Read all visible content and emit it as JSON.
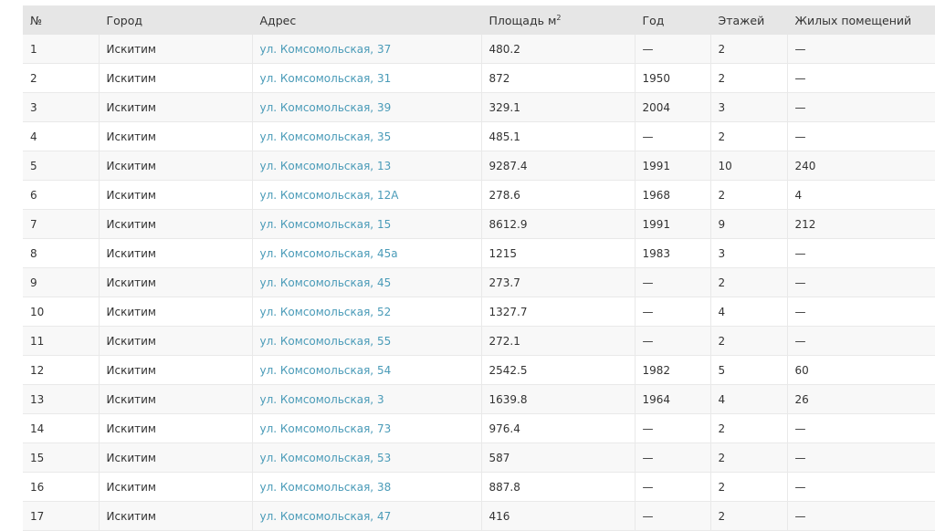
{
  "table": {
    "headers": {
      "num": "№",
      "city": "Город",
      "address": "Адрес",
      "area": "Площадь м",
      "area_sup": "2",
      "year": "Год",
      "floors": "Этажей",
      "residential": "Жилых помещений"
    },
    "rows": [
      {
        "num": "1",
        "city": "Искитим",
        "address": "ул. Комсомольская, 37",
        "area": "480.2",
        "year": "—",
        "floors": "2",
        "residential": "—"
      },
      {
        "num": "2",
        "city": "Искитим",
        "address": "ул. Комсомольская, 31",
        "area": "872",
        "year": "1950",
        "floors": "2",
        "residential": "—"
      },
      {
        "num": "3",
        "city": "Искитим",
        "address": "ул. Комсомольская, 39",
        "area": "329.1",
        "year": "2004",
        "floors": "3",
        "residential": "—"
      },
      {
        "num": "4",
        "city": "Искитим",
        "address": "ул. Комсомольская, 35",
        "area": "485.1",
        "year": "—",
        "floors": "2",
        "residential": "—"
      },
      {
        "num": "5",
        "city": "Искитим",
        "address": "ул. Комсомольская, 13",
        "area": "9287.4",
        "year": "1991",
        "floors": "10",
        "residential": "240"
      },
      {
        "num": "6",
        "city": "Искитим",
        "address": "ул. Комсомольская, 12А",
        "area": "278.6",
        "year": "1968",
        "floors": "2",
        "residential": "4"
      },
      {
        "num": "7",
        "city": "Искитим",
        "address": "ул. Комсомольская, 15",
        "area": "8612.9",
        "year": "1991",
        "floors": "9",
        "residential": "212"
      },
      {
        "num": "8",
        "city": "Искитим",
        "address": "ул. Комсомольская, 45а",
        "area": "1215",
        "year": "1983",
        "floors": "3",
        "residential": "—"
      },
      {
        "num": "9",
        "city": "Искитим",
        "address": "ул. Комсомольская, 45",
        "area": "273.7",
        "year": "—",
        "floors": "2",
        "residential": "—"
      },
      {
        "num": "10",
        "city": "Искитим",
        "address": "ул. Комсомольская, 52",
        "area": "1327.7",
        "year": "—",
        "floors": "4",
        "residential": "—"
      },
      {
        "num": "11",
        "city": "Искитим",
        "address": "ул. Комсомольская, 55",
        "area": "272.1",
        "year": "—",
        "floors": "2",
        "residential": "—"
      },
      {
        "num": "12",
        "city": "Искитим",
        "address": "ул. Комсомольская, 54",
        "area": "2542.5",
        "year": "1982",
        "floors": "5",
        "residential": "60"
      },
      {
        "num": "13",
        "city": "Искитим",
        "address": "ул. Комсомольская, 3",
        "area": "1639.8",
        "year": "1964",
        "floors": "4",
        "residential": "26"
      },
      {
        "num": "14",
        "city": "Искитим",
        "address": "ул. Комсомольская, 73",
        "area": "976.4",
        "year": "—",
        "floors": "2",
        "residential": "—"
      },
      {
        "num": "15",
        "city": "Искитим",
        "address": "ул. Комсомольская, 53",
        "area": "587",
        "year": "—",
        "floors": "2",
        "residential": "—"
      },
      {
        "num": "16",
        "city": "Искитим",
        "address": "ул. Комсомольская, 38",
        "area": "887.8",
        "year": "—",
        "floors": "2",
        "residential": "—"
      },
      {
        "num": "17",
        "city": "Искитим",
        "address": "ул. Комсомольская, 47",
        "area": "416",
        "year": "—",
        "floors": "2",
        "residential": "—"
      }
    ]
  },
  "colors": {
    "header_bg": "#e6e6e6",
    "link": "#4a9bb8",
    "text": "#333333"
  }
}
